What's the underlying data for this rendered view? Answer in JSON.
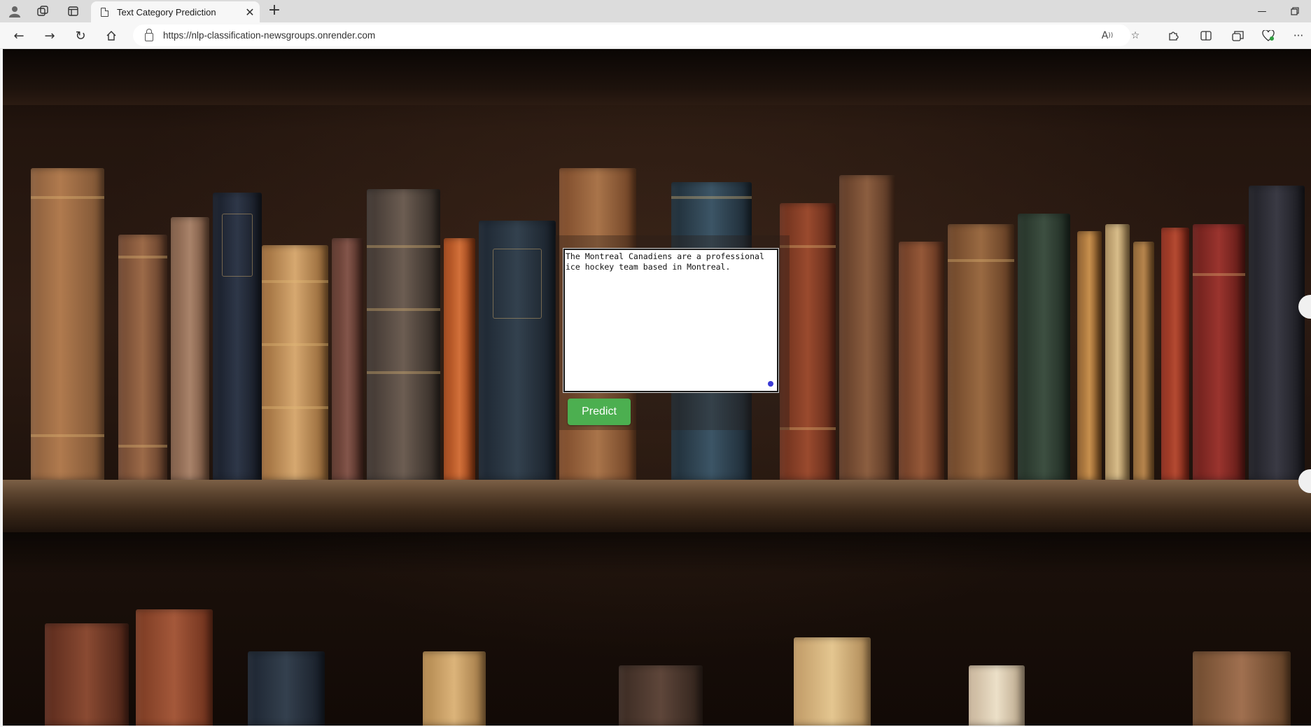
{
  "browser": {
    "tab_title": "Text Category Prediction",
    "url": "https://nlp-classification-newsgroups.onrender.com",
    "icons": {
      "profile": "profile-icon",
      "workspaces": "workspaces-icon",
      "tab_actions": "vertical-tabs-icon",
      "page": "page-icon",
      "close_tab": "close-icon",
      "new_tab": "plus-icon",
      "back": "back-arrow-icon",
      "forward": "forward-arrow-icon",
      "refresh": "refresh-icon",
      "home": "home-icon",
      "lock": "lock-icon",
      "read_aloud": "read-aloud-icon",
      "favorite": "star-icon",
      "extensions": "extensions-icon",
      "split_screen": "split-screen-icon",
      "collections": "collections-icon",
      "browser_essentials": "heart-pulse-icon",
      "more": "ellipsis-icon",
      "minimize": "minimize-icon",
      "restore": "restore-icon"
    }
  },
  "page": {
    "background": "bookshelf-photo",
    "textarea_value": "The Montreal Canadiens are a professional ice hockey team based in Montreal.",
    "predict_label": "Predict",
    "colors": {
      "predict_button": "#4caf50",
      "textarea_border": "#1a1a1a"
    }
  }
}
